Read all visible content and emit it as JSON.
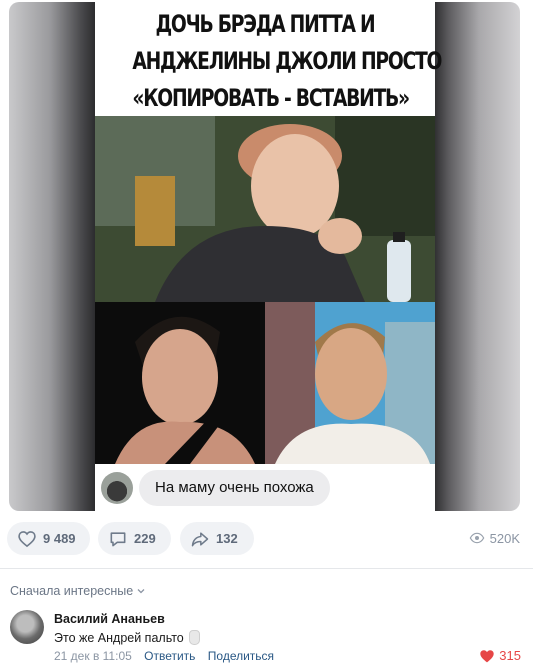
{
  "meme": {
    "title_line1": "ДОЧЬ БРЭДА ПИТТА И",
    "title_line2": "АНДЖЕЛИНЫ ДЖОЛИ ПРОСТО",
    "title_line3": "«КОПИРОВАТЬ - ВСТАВИТЬ»",
    "chat_message": "На маму очень похожа"
  },
  "actions": {
    "likes": "9 489",
    "comments": "229",
    "shares": "132",
    "views": "520K"
  },
  "comments_section": {
    "sort_label": "Сначала интересные",
    "comment": {
      "author": "Василий Ананьев",
      "text": "Это же Андрей пальто",
      "date": "21 дек в 11:05",
      "reply": "Ответить",
      "share": "Поделиться",
      "likes": "315"
    }
  },
  "colors": {
    "accent_link": "#2a5885",
    "like_red": "#e64646",
    "pill_bg": "#f0f2f5",
    "muted_text": "#8b95a3"
  },
  "icons": [
    "heart-icon",
    "comment-icon",
    "share-icon",
    "eye-icon",
    "chevron-down-icon",
    "heart-filled-icon"
  ]
}
